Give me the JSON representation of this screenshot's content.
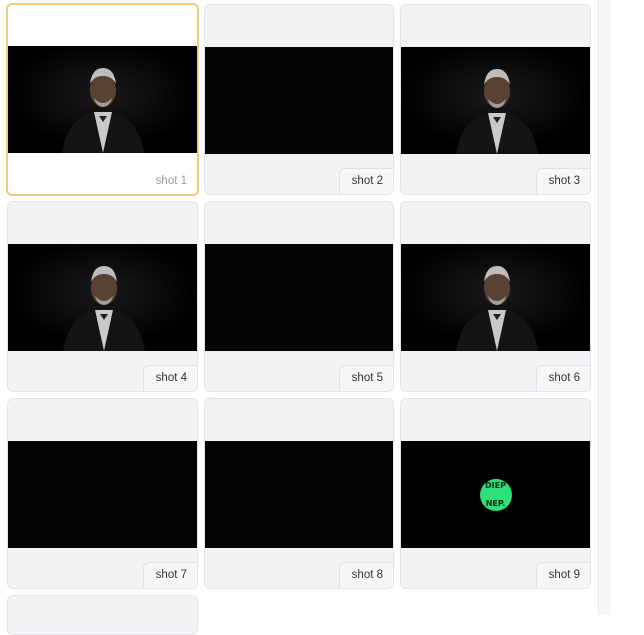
{
  "gallery": {
    "shots": [
      {
        "label": "shot 1",
        "image": "man-in-suit",
        "selected": true
      },
      {
        "label": "shot 2",
        "image": "black-frame",
        "selected": false
      },
      {
        "label": "shot 3",
        "image": "man-in-suit",
        "selected": false
      },
      {
        "label": "shot 4",
        "image": "man-in-suit",
        "selected": false
      },
      {
        "label": "shot 5",
        "image": "black-frame",
        "selected": false
      },
      {
        "label": "shot 6",
        "image": "man-in-suit",
        "selected": false
      },
      {
        "label": "shot 7",
        "image": "black-frame",
        "selected": false
      },
      {
        "label": "shot 8",
        "image": "black-frame",
        "selected": false
      },
      {
        "label": "shot 9",
        "image": "green-logo",
        "selected": false,
        "logo_text": "DIEP NEP."
      }
    ]
  },
  "colors": {
    "selected_border": "#f4c979",
    "card_background": "#f2f3f5",
    "logo_green": "#2ee07a"
  }
}
